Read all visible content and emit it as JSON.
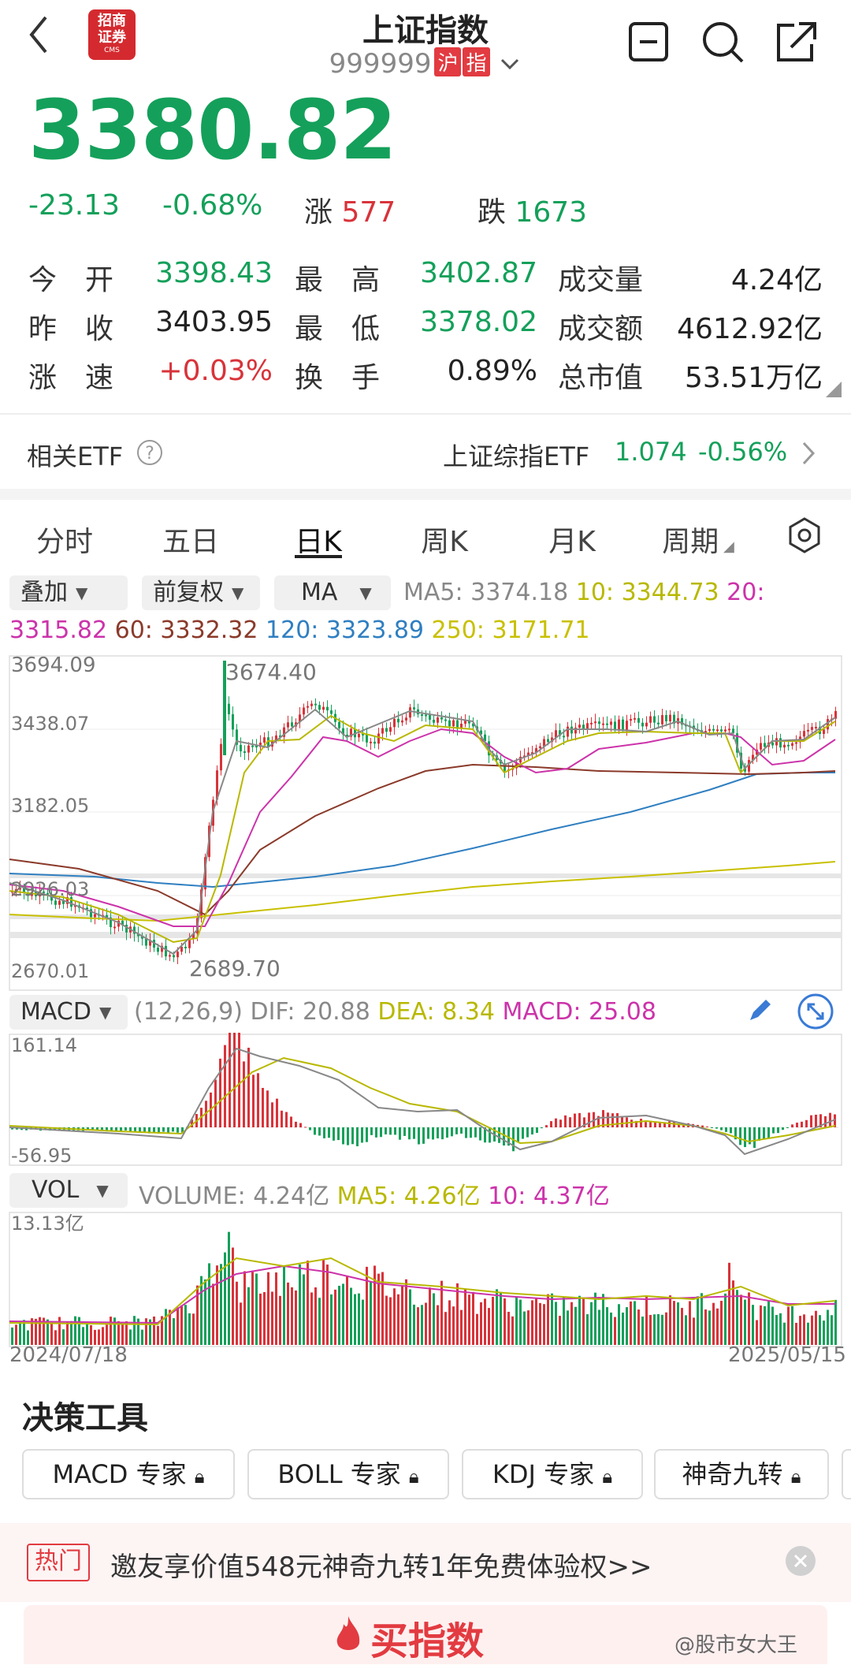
{
  "header": {
    "title": "上证指数",
    "code": "999999",
    "badges": [
      "沪",
      "指"
    ],
    "logo_top": "招商",
    "logo_bottom": "证券",
    "logo_sub": "CMS"
  },
  "quote": {
    "price": "3380.82",
    "change": "-23.13",
    "change_pct": "-0.68%",
    "up_label": "涨",
    "up_count": "577",
    "down_label": "跌",
    "down_count": "1673"
  },
  "stats": {
    "open_label": "今　开",
    "open": "3398.43",
    "high_label": "最　高",
    "high": "3402.87",
    "volume_label": "成交量",
    "volume": "4.24亿",
    "prev_label": "昨　收",
    "prev": "3403.95",
    "low_label": "最　低",
    "low": "3378.02",
    "amount_label": "成交额",
    "amount": "4612.92亿",
    "speed_label": "涨　速",
    "speed": "+0.03%",
    "turnover_label": "换　手",
    "turnover": "0.89%",
    "mktcap_label": "总市值",
    "mktcap": "53.51万亿"
  },
  "etf": {
    "label": "相关ETF",
    "name": "上证综指ETF",
    "price": "1.074",
    "change": "-0.56%"
  },
  "tabs": [
    "分时",
    "五日",
    "日K",
    "周K",
    "月K",
    "周期"
  ],
  "chart_controls": {
    "overlay": "叠加",
    "adjust": "前复权",
    "indicator": "MA"
  },
  "ma_line1": {
    "ma5": "MA5: 3374.18",
    "ma10": "10: 3344.73",
    "ma20_label": "20:"
  },
  "ma_line2": {
    "ma20_val": "3315.82",
    "ma60": "60: 3332.32",
    "ma120": "120: 3323.89",
    "ma250": "250: 3171.71"
  },
  "kline_axis": {
    "y_labels": [
      "3694.09",
      "3438.07",
      "3182.05",
      "2926.03",
      "2670.01"
    ],
    "max_label": "3674.40",
    "min_label": "2689.70"
  },
  "macd": {
    "label": "MACD",
    "params": "(12,26,9)",
    "dif": "DIF: 20.88",
    "dea": "DEA: 8.34",
    "macd": "MACD: 25.08",
    "y_top": "161.14",
    "y_bottom": "-56.95"
  },
  "vol": {
    "label": "VOL",
    "volume": "VOLUME: 4.24亿",
    "ma5": "MA5: 4.26亿",
    "ma10": "10: 4.37亿",
    "y_top": "13.13亿",
    "date_start": "2024/07/18",
    "date_end": "2025/05/15"
  },
  "tools": {
    "title": "决策工具",
    "items": [
      "MACD 专家",
      "BOLL 专家",
      "KDJ 专家",
      "神奇九转"
    ]
  },
  "promo": {
    "tag": "热门",
    "text": "邀友享价值548元神奇九转1年免费体验权>>"
  },
  "buy": {
    "label": "买指数"
  },
  "watermark": "@股市女大王",
  "colors": {
    "up": "#d8333a",
    "down": "#14a05a",
    "ma5": "#888888",
    "ma10": "#b8b800",
    "ma20": "#cc33aa",
    "ma60": "#8b3a2a",
    "ma120": "#2f7fc1",
    "ma250": "#c8c000"
  }
}
